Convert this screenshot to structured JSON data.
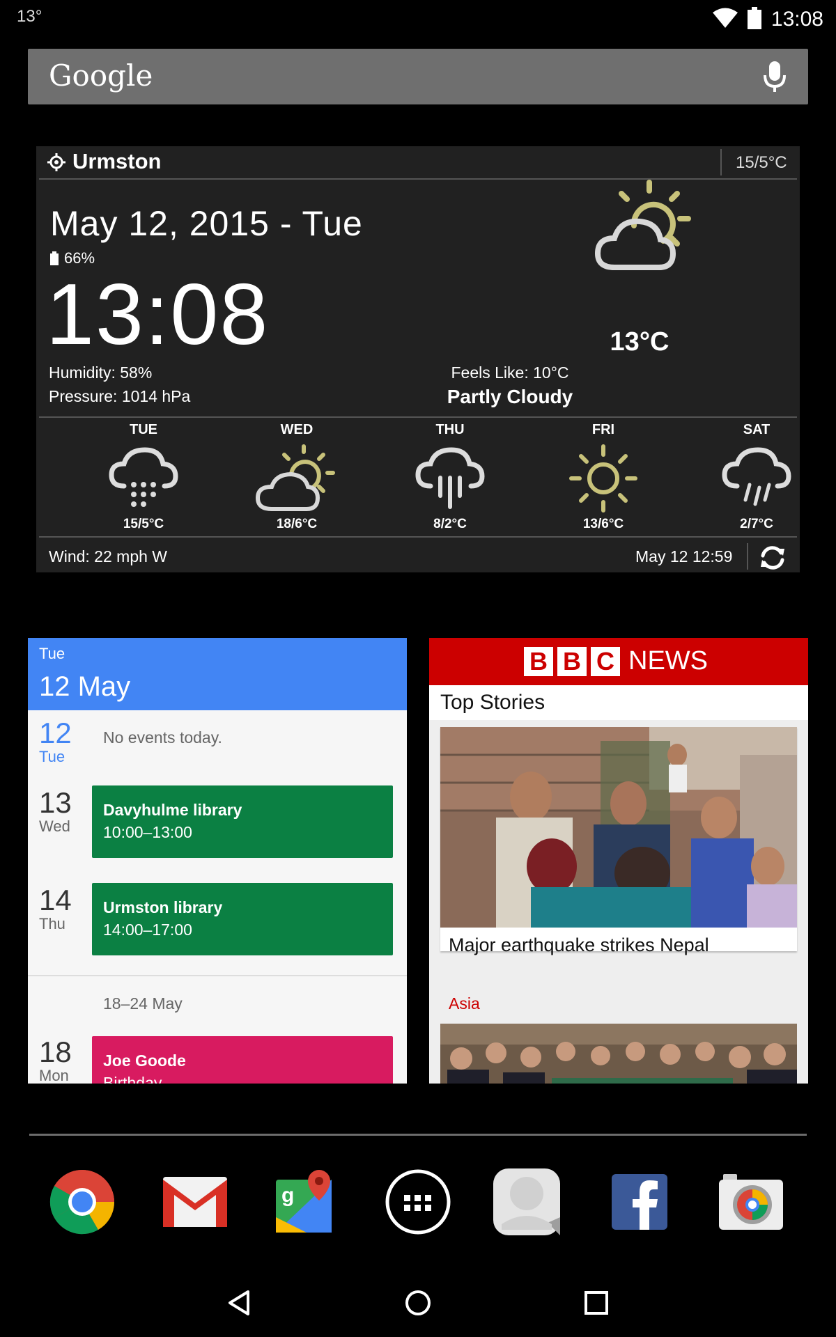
{
  "status_bar": {
    "notification_temp": "13°",
    "time": "13:08",
    "icons": [
      "wifi-icon",
      "battery-icon"
    ]
  },
  "search": {
    "logo": "Google",
    "icons": [
      "mic-icon"
    ]
  },
  "weather": {
    "location": "Urmston",
    "header_range": "15/5°C",
    "date": "May 12, 2015 - Tue",
    "battery": "66%",
    "time": "13:08",
    "humidity": "Humidity: 58%",
    "pressure": "Pressure: 1014 hPa",
    "temperature": "13°C",
    "feels_like": "Feels Like: 10°C",
    "condition": "Partly Cloudy",
    "forecast": [
      {
        "day": "TUE",
        "range": "15/5°C",
        "icon": "rain-heavy-icon"
      },
      {
        "day": "WED",
        "range": "18/6°C",
        "icon": "partly-cloudy-icon"
      },
      {
        "day": "THU",
        "range": "8/2°C",
        "icon": "rain-icon"
      },
      {
        "day": "FRI",
        "range": "13/6°C",
        "icon": "sun-icon"
      },
      {
        "day": "SAT",
        "range": "2/7°C",
        "icon": "showers-icon"
      }
    ],
    "wind": "Wind: 22 mph W",
    "updated": "May 12  12:59"
  },
  "calendar": {
    "header_dow": "Tue",
    "header_date": "12 May",
    "days": [
      {
        "num": "12",
        "label": "Tue"
      },
      {
        "num": "13",
        "label": "Wed"
      },
      {
        "num": "14",
        "label": "Thu"
      },
      {
        "num": "18",
        "label": "Mon"
      }
    ],
    "no_events": "No events today.",
    "events": [
      {
        "title": "Davyhulme library",
        "time": "10:00–13:00",
        "color": "#0b8043"
      },
      {
        "title": "Urmston library",
        "time": "14:00–17:00",
        "color": "#0b8043"
      },
      {
        "title": "Joe Goode",
        "time": "Birthday",
        "color": "#d81b60"
      }
    ],
    "week_range": "18–24 May",
    "accent": "#4285f4"
  },
  "bbc": {
    "logo_letters": [
      "B",
      "B",
      "C"
    ],
    "logo_word": "NEWS",
    "section": "Top Stories",
    "headline": "Major earthquake strikes Nepal",
    "category": "Asia",
    "brand_color": "#cc0000"
  },
  "dock": {
    "apps": [
      "chrome-icon",
      "gmail-icon",
      "maps-icon",
      "app-drawer-icon",
      "hangouts-icon",
      "facebook-icon",
      "camera-icon"
    ]
  },
  "navigation": {
    "icons": [
      "back-icon",
      "home-icon",
      "recents-icon"
    ]
  }
}
